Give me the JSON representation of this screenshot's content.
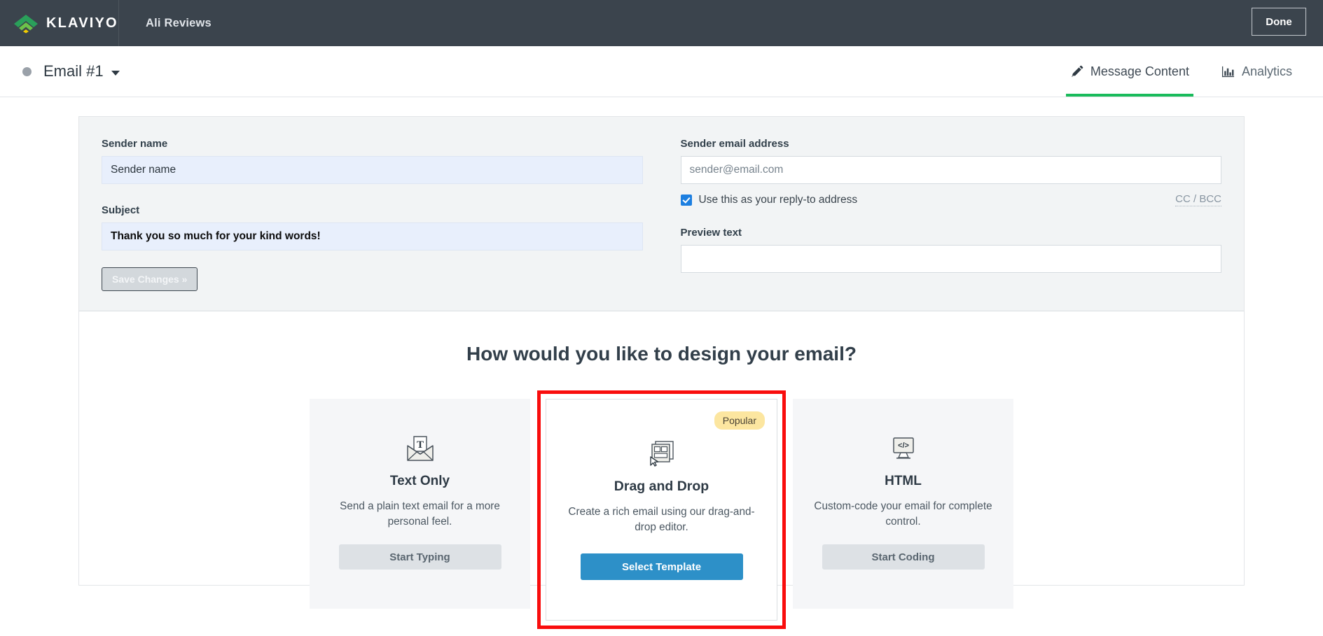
{
  "topbar": {
    "logo_icon": "klaviyo-logo-icon",
    "logo_word": "KLAVIYO",
    "account_name": "Ali Reviews",
    "done_label": "Done"
  },
  "subbar": {
    "status_dot": "status-dot",
    "email_title": "Email #1",
    "caret_icon": "chevron-down-icon",
    "tabs": [
      {
        "label": "Message Content",
        "icon": "pencil-icon",
        "active": true
      },
      {
        "label": "Analytics",
        "icon": "bar-chart-icon",
        "active": false
      }
    ]
  },
  "form": {
    "sender_name_label": "Sender name",
    "sender_name_value": "Sender name",
    "subject_label": "Subject",
    "subject_value": "Thank you so much for your kind words!",
    "save_label": "Save Changes »",
    "sender_email_label": "Sender email address",
    "sender_email_value": "",
    "sender_email_placeholder": "sender@email.com",
    "reply_to_label": "Use this as your reply-to address",
    "cc_bcc_label": "CC / BCC",
    "preview_text_label": "Preview text",
    "preview_text_value": "",
    "preview_text_placeholder": ""
  },
  "design": {
    "heading": "How would you like to design your email?",
    "cards": [
      {
        "icon": "envelope-text-icon",
        "title": "Text Only",
        "desc": "Send a plain text email for a more personal feel.",
        "button": "Start Typing",
        "badge": ""
      },
      {
        "icon": "drag-drop-layout-icon",
        "title": "Drag and Drop",
        "desc": "Create a rich email using our drag-and-drop editor.",
        "button": "Select Template",
        "badge": "Popular"
      },
      {
        "icon": "code-monitor-icon",
        "title": "HTML",
        "desc": "Custom-code your email for complete control.",
        "button": "Start Coding",
        "badge": ""
      }
    ]
  },
  "colors": {
    "topbar_bg": "#3b444d",
    "accent_green": "#19bb5b",
    "primary_blue": "#2d90c8",
    "checkbox_blue": "#1d7fe0",
    "badge_yellow": "#fce6a0",
    "highlight_red": "#f90d0d",
    "panel_gray": "#f2f4f5",
    "autofill_blue": "#e8effc"
  }
}
